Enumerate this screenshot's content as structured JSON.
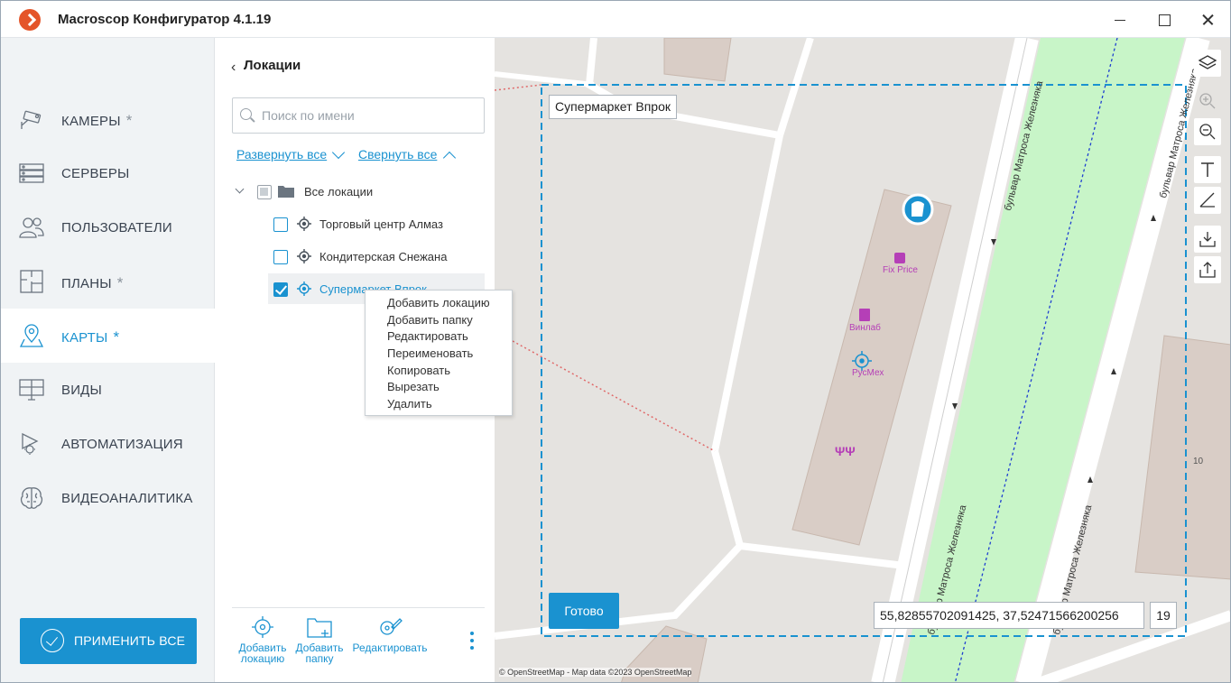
{
  "app": {
    "title": "Macroscop Конфигуратор 4.1.19"
  },
  "nav": {
    "items": [
      {
        "label": "КАМЕРЫ",
        "star": "*",
        "icon": "camera-icon"
      },
      {
        "label": "СЕРВЕРЫ",
        "star": "",
        "icon": "server-icon"
      },
      {
        "label": "ПОЛЬЗОВАТЕЛИ",
        "star": "",
        "icon": "users-icon"
      },
      {
        "label": "ПЛАНЫ",
        "star": "*",
        "icon": "floorplan-icon"
      },
      {
        "label": "КАРТЫ",
        "star": "*",
        "icon": "map-pin-icon"
      },
      {
        "label": "ВИДЫ",
        "star": "",
        "icon": "monitor-grid-icon"
      },
      {
        "label": "АВТОМАТИЗАЦИЯ",
        "star": "",
        "icon": "automation-gear-icon"
      },
      {
        "label": "ВИДЕОАНАЛИТИКА",
        "star": "",
        "icon": "brain-icon"
      }
    ],
    "active": "КАРТЫ",
    "apply_all": "ПРИМЕНИТЬ ВСЕ"
  },
  "locations": {
    "title": "Локации",
    "search_placeholder": "Поиск по имени",
    "expand_all": "Развернуть все",
    "collapse_all": "Свернуть все",
    "root": "Все локации",
    "items": [
      {
        "label": "Торговый центр Алмаз",
        "checked": false
      },
      {
        "label": "Кондитерская Снежана",
        "checked": false
      },
      {
        "label": "Супермаркет Впрок",
        "checked": true
      }
    ],
    "toolbar": {
      "add_location": "Добавить локацию",
      "add_folder": "Добавить папку",
      "edit": "Редактировать"
    }
  },
  "context_menu": {
    "items": [
      "Добавить локацию",
      "Добавить папку",
      "Редактировать",
      "Переименовать",
      "Копировать",
      "Вырезать",
      "Удалить"
    ]
  },
  "map": {
    "selected_label": "Супермаркет Впрок",
    "done": "Готово",
    "coordinates": "55,82855702091425, 37,52471566200256",
    "zoom": "19",
    "attribution": "© OpenStreetMap - Map data ©2023 OpenStreetMap",
    "pois": [
      "Fix Price",
      "Винлаб",
      "РусМех"
    ],
    "street_name": "бульвар Матроса Железняка",
    "house_number": "10",
    "colors": {
      "accent": "#1a92d0",
      "green_strip": "#c8f5c8",
      "building": "#d9cdc6",
      "poi": "#b53fb7"
    }
  }
}
